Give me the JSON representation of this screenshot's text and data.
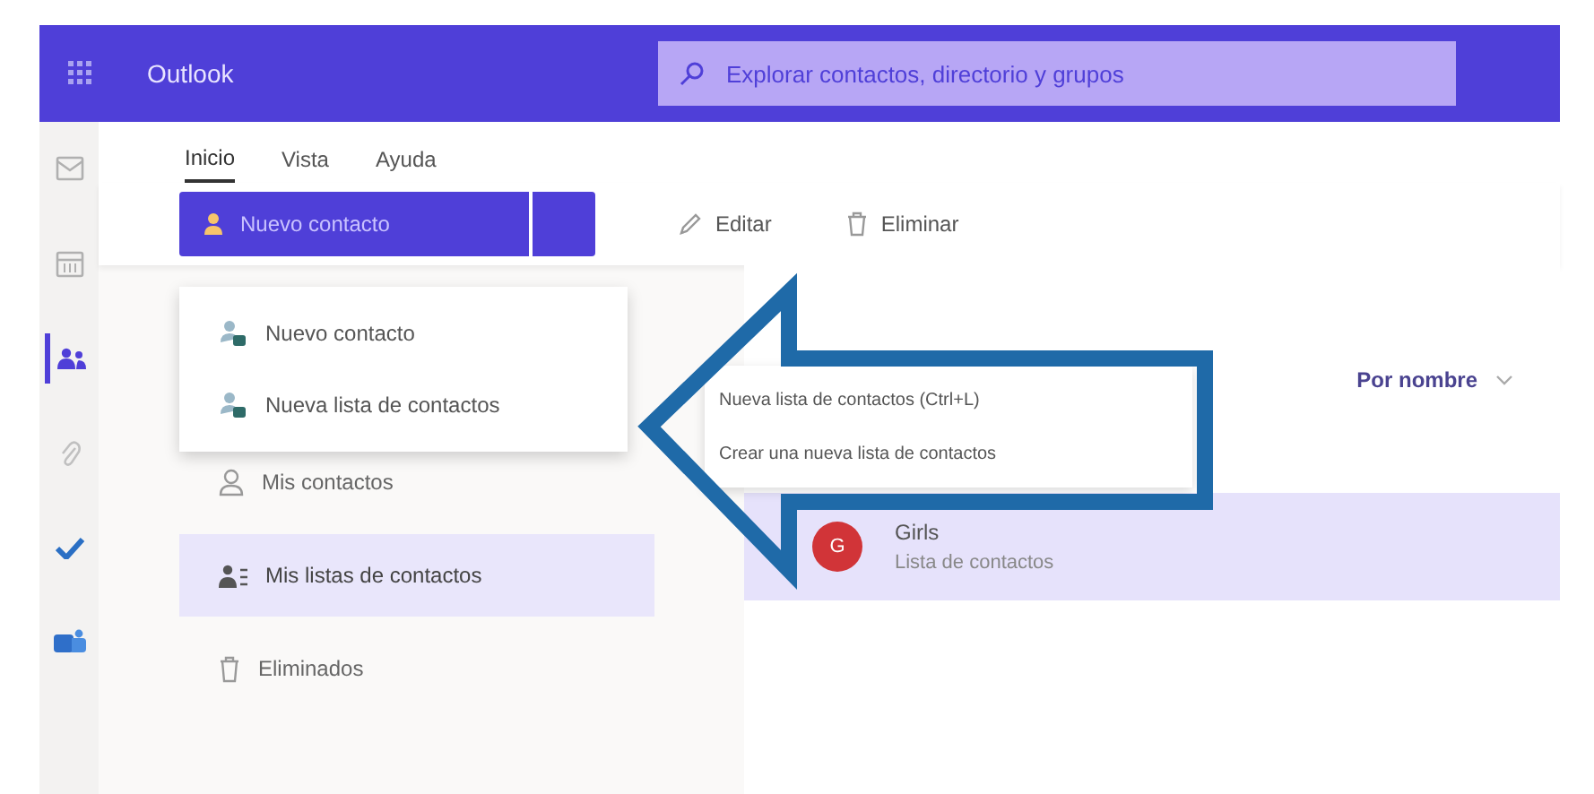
{
  "app": {
    "title": "Outlook"
  },
  "search": {
    "placeholder": "Explorar contactos, directorio y grupos"
  },
  "rail": [
    {
      "kind": "mail",
      "selected": false
    },
    {
      "kind": "calendar",
      "selected": false
    },
    {
      "kind": "people",
      "selected": true
    },
    {
      "kind": "attach",
      "selected": false
    },
    {
      "kind": "todo",
      "selected": false
    },
    {
      "kind": "teams",
      "selected": false
    }
  ],
  "tabs": [
    {
      "label": "Inicio",
      "selected": true
    },
    {
      "label": "Vista",
      "selected": false
    },
    {
      "label": "Ayuda",
      "selected": false
    }
  ],
  "new_button": {
    "label": "Nuevo contacto"
  },
  "toolbar": [
    {
      "kind": "edit",
      "label": "Editar"
    },
    {
      "kind": "delete",
      "label": "Eliminar"
    }
  ],
  "new_menu": [
    {
      "label": "Nuevo contacto"
    },
    {
      "label": "Nueva lista de contactos"
    }
  ],
  "tooltip": {
    "title": "Nueva lista de contactos (Ctrl+L)",
    "description": "Crear una nueva lista de contactos"
  },
  "nav": [
    {
      "kind": "person",
      "label": "Mis contactos",
      "selected": false
    },
    {
      "kind": "list",
      "label": "Mis listas de contactos",
      "selected": true
    },
    {
      "kind": "trash",
      "label": "Eliminados",
      "selected": false
    }
  ],
  "sort": {
    "label": "Por nombre"
  },
  "contacts": [
    {
      "initial": "G",
      "name": "Girls",
      "subtitle": "Lista de contactos",
      "color": "#d13438",
      "selected": true
    }
  ]
}
